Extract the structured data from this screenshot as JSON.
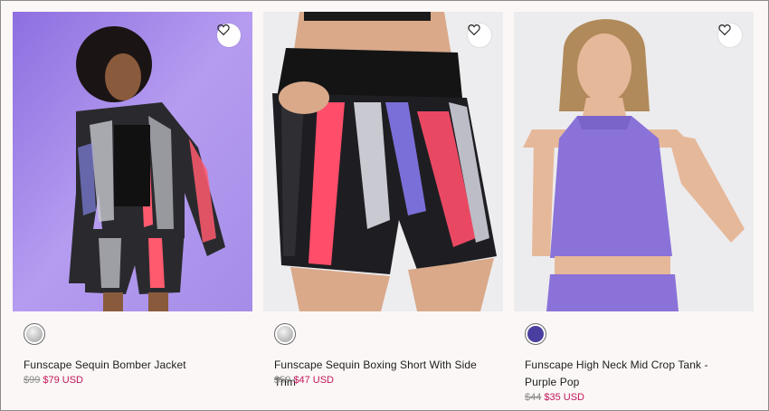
{
  "products": [
    {
      "name": "Funscape Sequin Bomber Jacket",
      "price_old": "$99",
      "price_new": "$79 USD",
      "swatch_color": "#bdbdbd",
      "wishlist_icon": "heart-outline-icon"
    },
    {
      "name": "Funscape Sequin Boxing Short With Side Trim",
      "price_old": "$59",
      "price_new": "$47 USD",
      "swatch_color": "#bdbdbd",
      "wishlist_icon": "heart-outline-icon"
    },
    {
      "name": "Funscape High Neck Mid Crop Tank - Purple Pop",
      "price_old": "$44",
      "price_new": "$35 USD",
      "swatch_color": "#4a3ea0",
      "wishlist_icon": "heart-outline-icon"
    }
  ],
  "colors": {
    "page_bg": "#fbf7f6",
    "sale_price": "#c2185b",
    "strike_price": "#8b8b8b"
  }
}
